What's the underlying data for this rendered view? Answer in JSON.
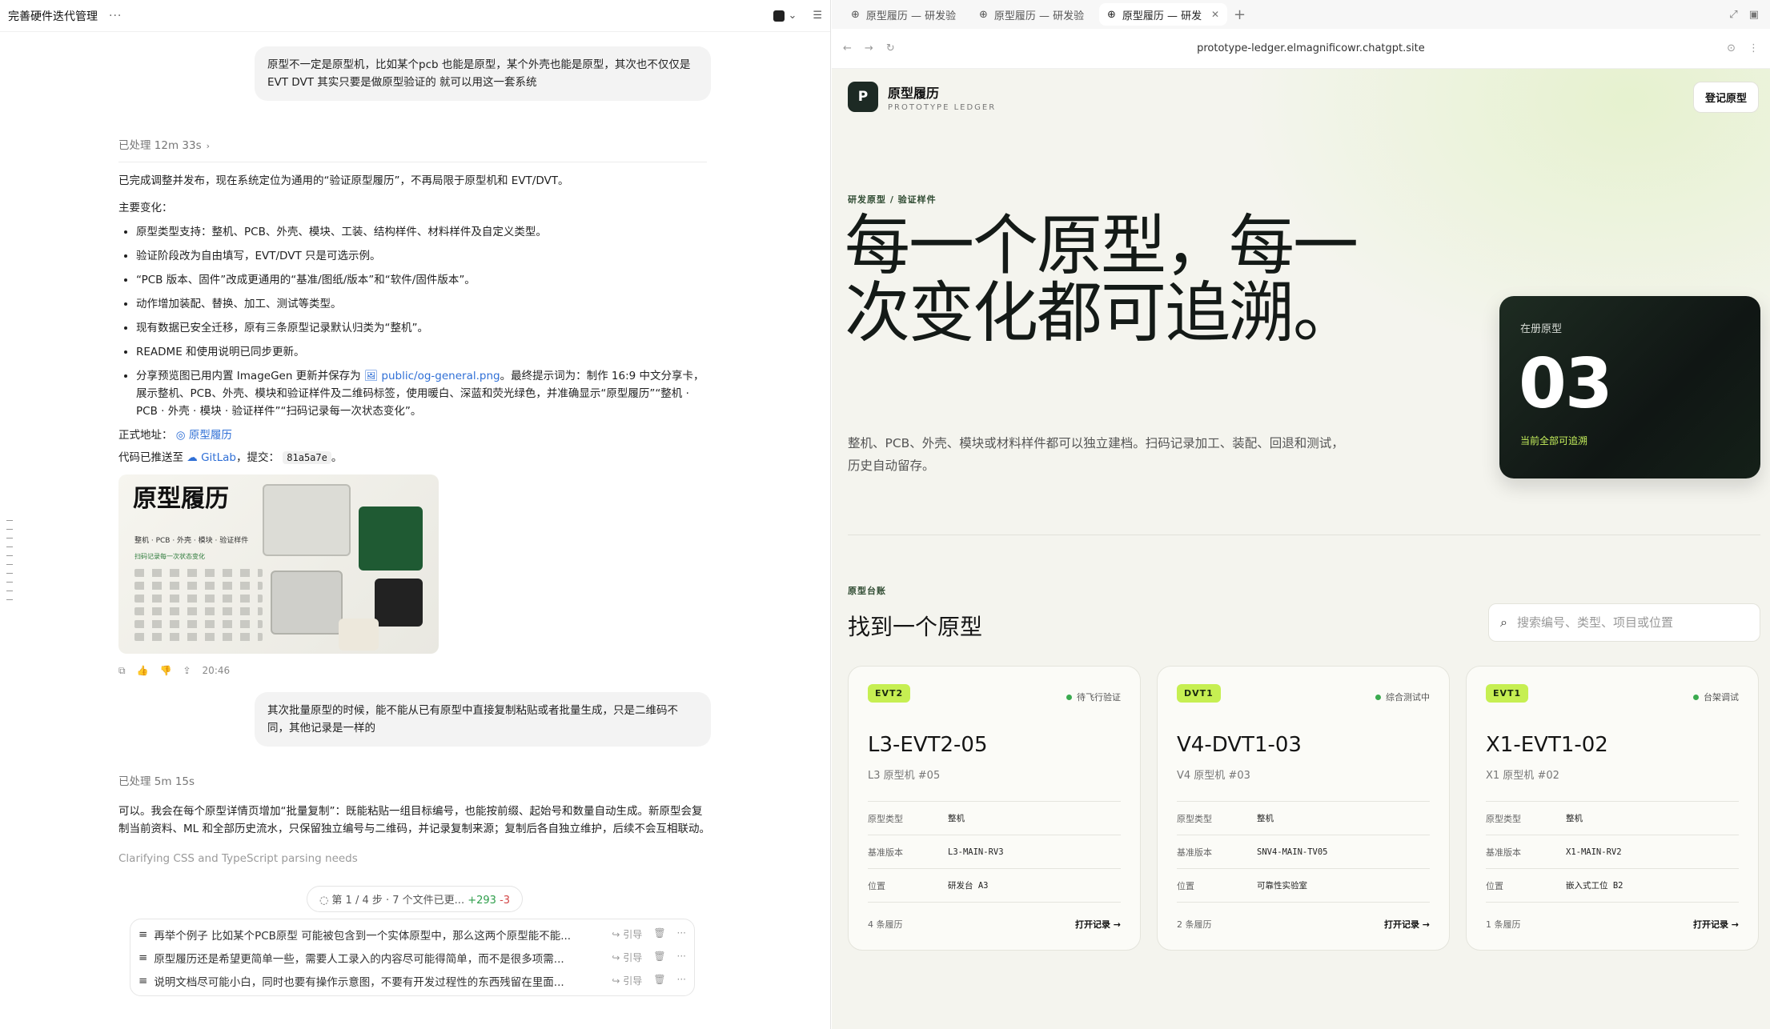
{
  "left": {
    "header": {
      "title": "完善硬件迭代管理",
      "more": "···"
    },
    "user_msg_1": "原型不一定是原型机，比如某个pcb 也能是原型，某个外壳也能是原型，其次也不仅仅是EVT DVT 其实只要是做原型验证的 就可以用这一套系统",
    "processed_1": "已处理 12m 33s",
    "reply": {
      "intro": "已完成调整并发布，现在系统定位为通用的“验证原型履历”，不再局限于原型机和 EVT/DVT。",
      "changes_title": "主要变化：",
      "bullets": [
        "原型类型支持：整机、PCB、外壳、模块、工装、结构样件、材料样件及自定义类型。",
        "验证阶段改为自由填写，EVT/DVT 只是可选示例。",
        "“PCB 版本、固件”改成更通用的“基准/图纸/版本”和“软件/固件版本”。",
        "动作增加装配、替换、加工、测试等类型。",
        "现有数据已安全迁移，原有三条原型记录默认归类为“整机”。",
        "README 和使用说明已同步更新。"
      ],
      "og_bullet_pre": "分享预览图已用内置 ImageGen 更新并保存为",
      "og_file": "public/og-general.png",
      "og_bullet_post": "。最终提示词为：制作 16:9 中文分享卡，展示整机、PCB、外壳、模块和验证样件及二维码标签，使用暖白、深蓝和荧光绿色，并准确显示“原型履历”“整机 · PCB · 外壳 · 模块 · 验证样件”“扫码记录每一次状态变化”。",
      "address_label": "正式地址：",
      "address_link": "原型履历",
      "push_pre": "代码已推送至",
      "push_link": "GitLab",
      "push_mid": "，提交：",
      "commit": "81a5a7e",
      "push_end": "。"
    },
    "og_image": {
      "title": "原型履历",
      "tags": "整机 · PCB · 外壳 · 模块 · 验证样件",
      "scan": "扫码记录每一次状态变化"
    },
    "msg_time": "20:46",
    "user_msg_2": "其次批量原型的时候，能不能从已有原型中直接复制粘贴或者批量生成，只是二维码不同，其他记录是一样的",
    "processed_2": "已处理 5m 15s",
    "reply_2": "可以。我会在每个原型详情页增加“批量复制”：既能粘贴一组目标编号，也能按前缀、起始号和数量自动生成。新原型会复制当前资料、ML 和全部历史流水，只保留独立编号与二维码，并记录复制来源；复制后各自独立维护，后续不会互相联动。",
    "clarify": "Clarifying CSS and TypeScript parsing needs",
    "step": {
      "text": "第 1 / 4 步 · 7 个文件已更...",
      "plus": "+293",
      "minus": "-3"
    },
    "queue": [
      {
        "text": "再举个例子 比如某个PCB原型 可能被包含到一个实体原型中，那么这两个原型能不能...",
        "quote": "引导"
      },
      {
        "text": "原型履历还是希望更简单一些，需要人工录入的内容尽可能得简单，而不是很多项需...",
        "quote": "引导"
      },
      {
        "text": "说明文档尽可能小白，同时也要有操作示意图，不要有开发过程性的东西残留在里面...",
        "quote": "引导"
      }
    ]
  },
  "browser": {
    "tabs": [
      {
        "label": "原型履历 — 研发验",
        "active": false
      },
      {
        "label": "原型履历 — 研发验",
        "active": false
      },
      {
        "label": "原型履历 — 研发",
        "active": true
      }
    ],
    "url": "prototype-ledger.elmagnificowr.chatgpt.site"
  },
  "site": {
    "logo_letter": "P",
    "brand_name": "原型履历",
    "brand_sub": "PROTOTYPE LEDGER",
    "register_button": "登记原型",
    "crumb": "研发原型 / 验证样件",
    "hero_title": "每一个原型，每一次变化都可追溯。",
    "hero_desc": "整机、PCB、外壳、模块或材料样件都可以独立建档。扫码记录加工、装配、回退和测试，历史自动留存。",
    "count_card": {
      "label": "在册原型",
      "value": "03",
      "sub": "当前全部可追溯"
    },
    "section_label": "原型台账",
    "section_title": "找到一个原型",
    "search_placeholder": "搜索编号、类型、项目或位置",
    "cards": [
      {
        "badge": "EVT2",
        "status": "待飞行验证",
        "id": "L3-EVT2-05",
        "sub": "L3 原型机 #05",
        "rows": [
          {
            "k": "原型类型",
            "v": "整机"
          },
          {
            "k": "基准版本",
            "v": "L3-MAIN-RV3"
          },
          {
            "k": "位置",
            "v": "研发台 A3"
          }
        ],
        "history": "4 条履历",
        "open": "打开记录 →"
      },
      {
        "badge": "DVT1",
        "status": "综合测试中",
        "id": "V4-DVT1-03",
        "sub": "V4 原型机 #03",
        "rows": [
          {
            "k": "原型类型",
            "v": "整机"
          },
          {
            "k": "基准版本",
            "v": "SNV4-MAIN-TV05"
          },
          {
            "k": "位置",
            "v": "可靠性实验室"
          }
        ],
        "history": "2 条履历",
        "open": "打开记录 →"
      },
      {
        "badge": "EVT1",
        "status": "台架调试",
        "id": "X1-EVT1-02",
        "sub": "X1 原型机 #02",
        "rows": [
          {
            "k": "原型类型",
            "v": "整机"
          },
          {
            "k": "基准版本",
            "v": "X1-MAIN-RV2"
          },
          {
            "k": "位置",
            "v": "嵌入式工位 B2"
          }
        ],
        "history": "1 条履历",
        "open": "打开记录 →"
      }
    ]
  }
}
